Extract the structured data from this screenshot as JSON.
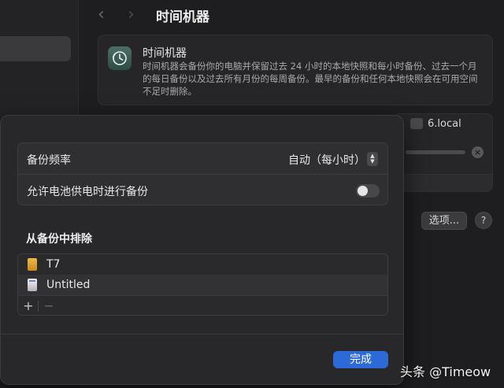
{
  "window": {
    "title": "时间机器",
    "nav_back": "‹",
    "nav_forward": "›"
  },
  "info_card": {
    "title": "时间机器",
    "description": "时间机器会备份你的电脑并保留过去 24 小时的本地快照和每小时备份、过去一个月的每日备份以及过去所有月份的每周备份。最早的备份和任何本地快照会在可用空间不足时删除。"
  },
  "disk": {
    "name": "6.local",
    "remove_glyph": "×"
  },
  "background_buttons": {
    "options_label": "选项...",
    "help_label": "?"
  },
  "sheet": {
    "frequency_label": "备份频率",
    "frequency_value": "自动（每小时）",
    "battery_label": "允许电池供电时进行备份",
    "battery_enabled": false,
    "exclude_title": "从备份中排除",
    "exclude_items": [
      {
        "label": "T7",
        "icon": "external-drive-orange-icon"
      },
      {
        "label": "Untitled",
        "icon": "external-drive-white-icon"
      }
    ],
    "add_label": "+",
    "remove_label": "−",
    "done_label": "完成"
  },
  "colors": {
    "accent": "#2c6ad8",
    "background": "#1c1c1e",
    "sheet": "#28282a"
  },
  "watermark": "头条 @Timeow"
}
